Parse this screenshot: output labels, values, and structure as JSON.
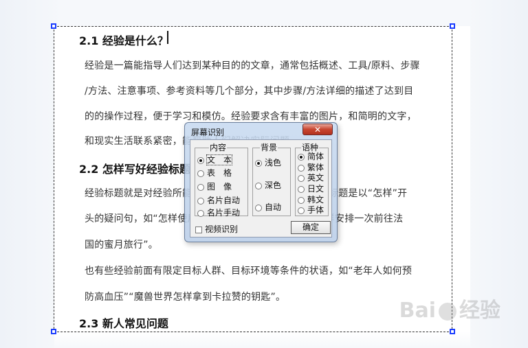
{
  "document": {
    "section1": {
      "heading": "2.1 经验是什么？",
      "lines": [
        "经验是一篇能指导人们达到某种目的的文章，通常包括概述、工具/原料、步骤",
        "/方法、注意事项、参考资料等几个部分，其中步骤/方法详细的描述了达到目",
        "的的操作过程，便于学习和模仿。经验要求含有丰富的图片，和简明的文字，",
        "和现实生活联系紧密，能帮助人们解决实际问题。"
      ]
    },
    "section2": {
      "heading": "2.2 怎样写好经验标题",
      "lines": [
        "经验标题就是对经验所能达到的目的的描述。标题的最好标题是以“怎样”开",
        "头的疑问句，如“怎样使用某款软件”“怎样预订酒店”“怎样安排一次前往法",
        "国的蜜月旅行”。",
        "也有些经验前面有限定目标人群、目标环境等条件的状语，如“老年人如何预",
        "防高血压”“魔兽世界怎样拿到卡拉赞的钥匙”。"
      ]
    },
    "section3": {
      "heading": "2.3 新人常见问题"
    }
  },
  "watermark": {
    "left": "Bai",
    "right": "经验"
  },
  "dialog": {
    "title": "屏幕识别",
    "close_label": "✕",
    "content_group": {
      "label": "内容",
      "options": [
        "文　本",
        "表　格",
        "图　像",
        "名片自动",
        "名片手动"
      ],
      "selected": "文　本"
    },
    "background_group": {
      "label": "背景",
      "options": [
        "浅色",
        "深色",
        "自动"
      ],
      "selected": "浅色"
    },
    "language_group": {
      "label": "语种",
      "options": [
        "简体",
        "繁体",
        "英文",
        "日文",
        "韩文",
        "手体"
      ],
      "selected": "简体"
    },
    "video_checkbox_label": "视频识别",
    "video_checked": false,
    "ok_label": "确定"
  }
}
